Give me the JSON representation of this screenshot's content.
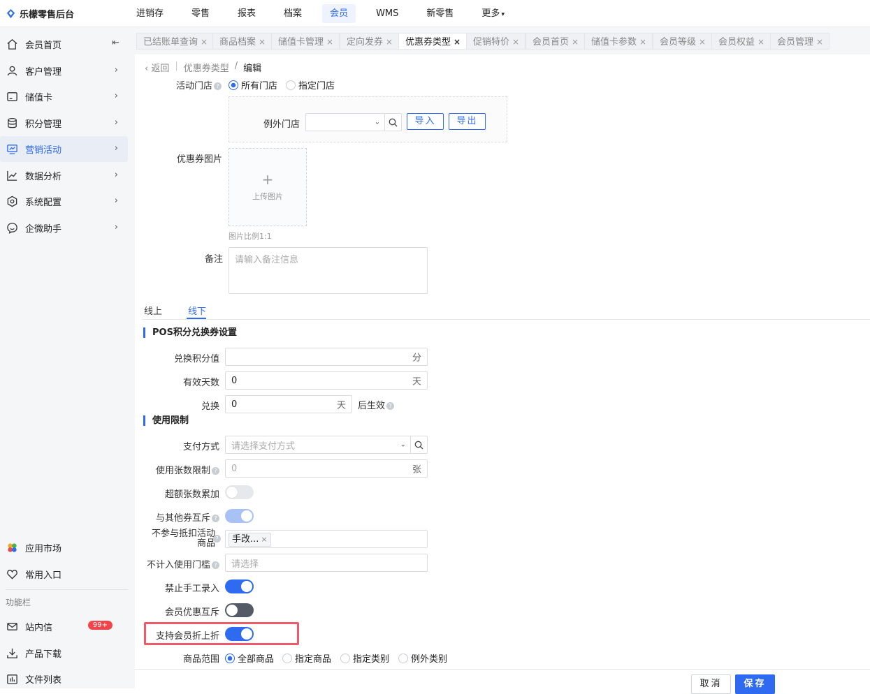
{
  "app": {
    "title": "乐檬零售后台"
  },
  "topnav": [
    {
      "label": "进销存"
    },
    {
      "label": "零售"
    },
    {
      "label": "报表"
    },
    {
      "label": "档案"
    },
    {
      "label": "会员"
    },
    {
      "label": "WMS"
    },
    {
      "label": "新零售"
    },
    {
      "label": "更多"
    }
  ],
  "sidebar": {
    "items": [
      {
        "label": "会员首页"
      },
      {
        "label": "客户管理"
      },
      {
        "label": "储值卡"
      },
      {
        "label": "积分管理"
      },
      {
        "label": "营销活动"
      },
      {
        "label": "数据分析"
      },
      {
        "label": "系统配置"
      },
      {
        "label": "企微助手"
      }
    ],
    "bottom": [
      {
        "label": "应用市场"
      },
      {
        "label": "常用入口"
      }
    ],
    "section_label": "功能栏",
    "func": [
      {
        "label": "站内信",
        "badge": "99+"
      },
      {
        "label": "产品下载"
      },
      {
        "label": "文件列表"
      }
    ]
  },
  "tabs": [
    {
      "label": "已结账单查询"
    },
    {
      "label": "商品档案"
    },
    {
      "label": "储值卡管理"
    },
    {
      "label": "定向发券"
    },
    {
      "label": "优惠券类型"
    },
    {
      "label": "促销特价"
    },
    {
      "label": "会员首页"
    },
    {
      "label": "储值卡参数"
    },
    {
      "label": "会员等级"
    },
    {
      "label": "会员权益"
    },
    {
      "label": "会员管理"
    }
  ],
  "breadcrumb": {
    "back": "返回",
    "parent": "优惠券类型",
    "sep": "/",
    "current": "编辑"
  },
  "form": {
    "store_label": "活动门店",
    "store_all": "所有门店",
    "store_specific": "指定门店",
    "except_store_label": "例外门店",
    "import_btn": "导入",
    "export_btn": "导出",
    "image_label": "优惠券图片",
    "upload_text": "上传图片",
    "image_hint": "图片比例1:1",
    "remark_label": "备注",
    "remark_placeholder": "请输入备注信息"
  },
  "subtabs": [
    {
      "label": "线上"
    },
    {
      "label": "线下"
    }
  ],
  "pos_section": {
    "title": "POS积分兑换券设置",
    "points_label": "兑换积分值",
    "points_value": "",
    "points_unit": "分",
    "days_label": "有效天数",
    "days_value": "0",
    "days_unit": "天",
    "exchange_label": "兑换",
    "exchange_value": "0",
    "exchange_unit": "天",
    "effect_text": "后生效"
  },
  "limit_section": {
    "title": "使用限制",
    "pay_label": "支付方式",
    "pay_placeholder": "请选择支付方式",
    "count_label": "使用张数限制",
    "count_placeholder": "0",
    "count_unit": "张",
    "overlimit_label": "超额张数累加",
    "mutex_label": "与其他券互斥",
    "exclude_label_1": "不参与抵扣活动",
    "exclude_label_2": "商品",
    "exclude_tag": "手改...",
    "threshold_label": "不计入使用门槛",
    "threshold_placeholder": "请选择",
    "manual_label": "禁止手工录入",
    "member_mutex_label": "会员优惠互斥",
    "member_discount_label": "支持会员折上折",
    "scope_label": "商品范围",
    "scope_options": [
      {
        "label": "全部商品"
      },
      {
        "label": "指定商品"
      },
      {
        "label": "指定类别"
      },
      {
        "label": "例外类别"
      }
    ]
  },
  "footer": {
    "cancel": "取消",
    "save": "保存"
  },
  "colors": {
    "accent": "#2f6bf0",
    "highlight": "#ef5a6a",
    "badge": "#f0454b"
  }
}
